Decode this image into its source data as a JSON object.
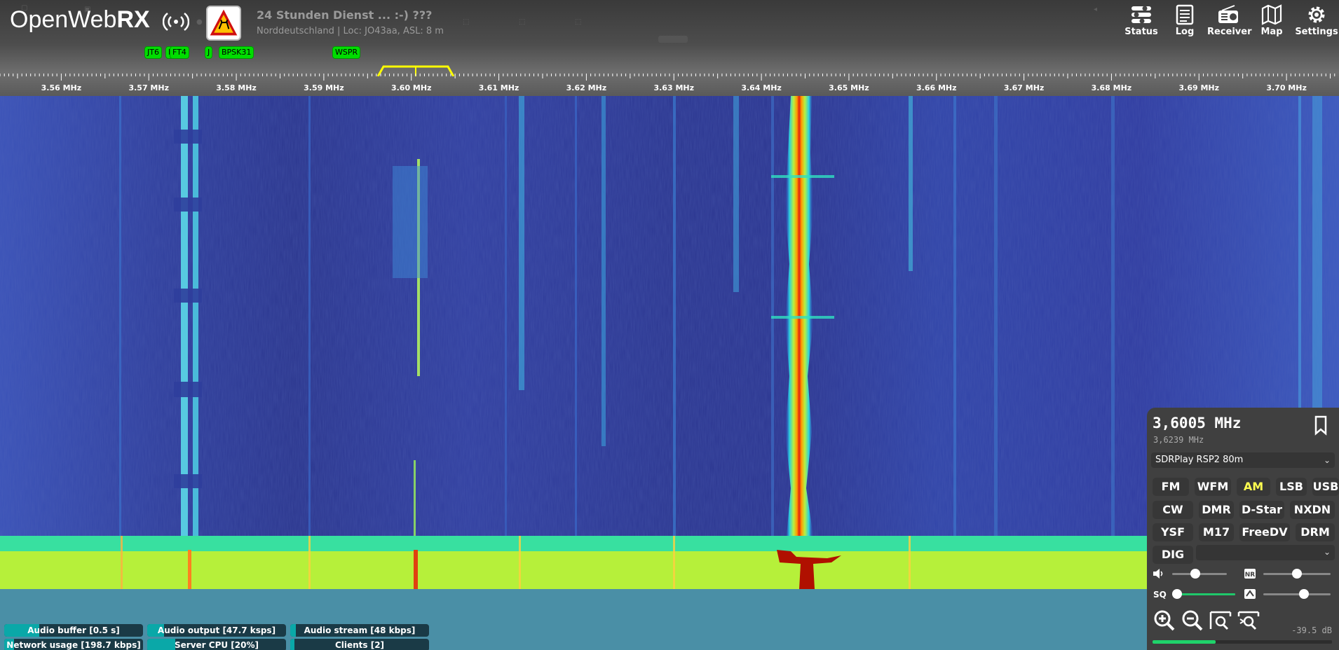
{
  "app": {
    "logo_text": "OpenWebRX",
    "receiver_name": "24 Stunden Dienst ... :-) ???",
    "receiver_location": "Norddeutschland | Loc: JO43aa, ASL: 8 m"
  },
  "top_nav": {
    "status": "Status",
    "log": "Log",
    "receiver": "Receiver",
    "map": "Map",
    "settings": "Settings"
  },
  "bookmarks": [
    {
      "label": "FT",
      "freq_mhz": 3.5733
    },
    {
      "label": "JT6",
      "freq_mhz": 3.5705
    },
    {
      "label": "J",
      "freq_mhz": 3.5727
    },
    {
      "label": "FT8",
      "freq_mhz": 3.573
    },
    {
      "label": "FT4",
      "freq_mhz": 3.5735
    },
    {
      "label": "J",
      "freq_mhz": 3.5768
    },
    {
      "label": "BPSK31",
      "freq_mhz": 3.58
    },
    {
      "label": "WSPR",
      "freq_mhz": 3.5926
    }
  ],
  "scale": {
    "labels": [
      "3.56 MHz",
      "3.57 MHz",
      "3.58 MHz",
      "3.59 MHz",
      "3.60 MHz",
      "3.61 MHz",
      "3.62 MHz",
      "3.63 MHz",
      "3.64 MHz",
      "3.65 MHz",
      "3.66 MHz",
      "3.67 MHz",
      "3.68 MHz",
      "3.69 MHz",
      "3.70 MHz"
    ],
    "start_mhz": 3.553,
    "end_mhz": 3.706,
    "passband_low_mhz": 3.5965,
    "passband_high_mhz": 3.6045
  },
  "receiver_panel": {
    "frequency": "3,6005 MHz",
    "frequency_secondary": "3,6239 MHz",
    "profile": "SDRPlay RSP2 80m",
    "modes": [
      "FM",
      "WFM",
      "AM",
      "LSB",
      "USB",
      "CW",
      "DMR",
      "D-Star",
      "NXDN",
      "YSF",
      "M17",
      "FreeDV",
      "DRM",
      "DIG"
    ],
    "active_mode": "AM",
    "volume_level": 0.4,
    "nr_level": 0.5,
    "squelch_level": 0.0,
    "gain_level": 0.62,
    "smeter_text": "-39.5 dB",
    "smeter_level": 0.35
  },
  "status_bars": [
    {
      "label": "Audio buffer [0.5 s]",
      "level": 0.25
    },
    {
      "label": "Audio output [47.7 ksps]",
      "level": 0.12
    },
    {
      "label": "Audio stream [48 kbps]",
      "level": 0.04
    },
    {
      "label": "Network usage [198.7 kbps]",
      "level": 0.07
    },
    {
      "label": "Server CPU [20%]",
      "level": 0.2
    },
    {
      "label": "Clients [2]",
      "level": 0.02
    }
  ],
  "colors": {
    "accent_green": "#00dd00",
    "active_mode": "#ffff50",
    "status_fill": "#0aa8a8"
  }
}
